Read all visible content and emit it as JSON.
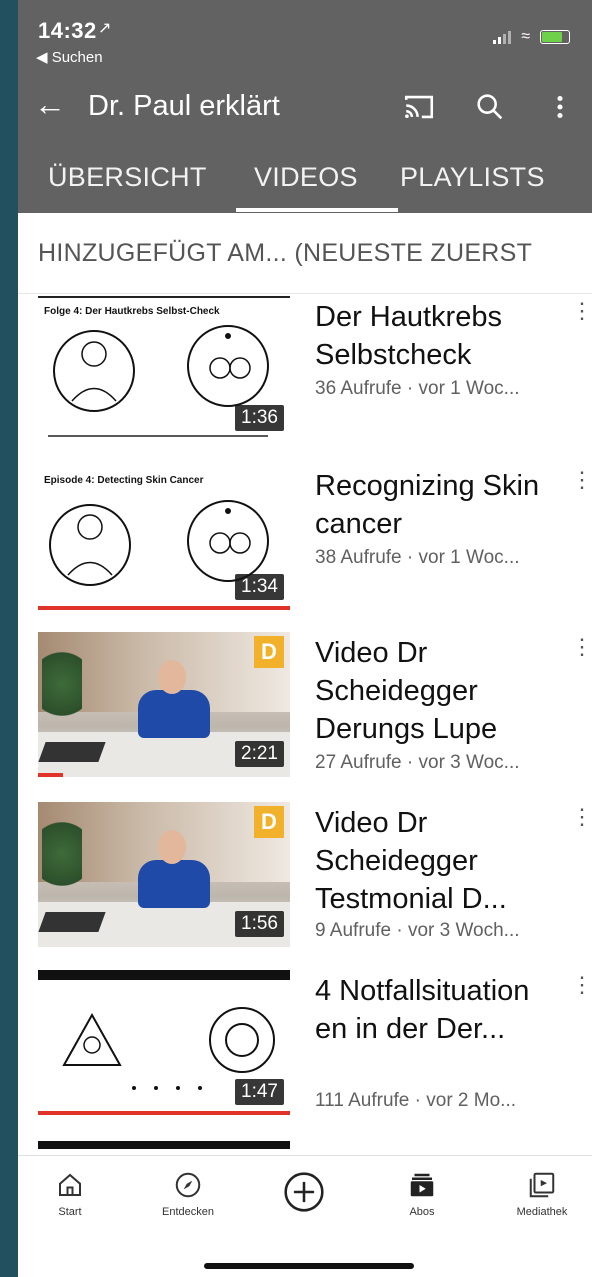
{
  "status_bar": {
    "time": "14:32",
    "location_arrow": "↗",
    "back_label": "◀ Suchen",
    "battery_color": "#6fd04a"
  },
  "header": {
    "title": "Dr. Paul erklärt",
    "background": "#626262",
    "icons": [
      "back-arrow-icon",
      "cast-icon",
      "search-icon",
      "more-vertical-icon"
    ]
  },
  "tabs": [
    {
      "label": "ÜBERSICHT",
      "selected": false
    },
    {
      "label": "VIDEOS",
      "selected": true
    },
    {
      "label": "PLAYLISTS",
      "selected": false
    }
  ],
  "sort": {
    "label": "HINZUGEFÜGT AM... (NEUESTE ZUERST"
  },
  "videos": [
    {
      "title": "Der Hautkrebs Selbstcheck",
      "meta": "36 Aufrufe · vor 1 Woc...",
      "duration": "1:36",
      "thumb_caption": "Folge 4: Der Hautkrebs Selbst-Check",
      "watched_fraction": 0.0
    },
    {
      "title": "Recognizing Skin cancer",
      "meta": "38 Aufrufe · vor 1 Woc...",
      "duration": "1:34",
      "thumb_caption": "Episode 4: Detecting Skin Cancer",
      "watched_fraction": 1.0
    },
    {
      "title": "Video Dr Scheidegger Derungs Lupe",
      "meta": "27 Aufrufe · vor 3 Woc...",
      "duration": "2:21",
      "badge": "D",
      "watched_fraction": 0.1
    },
    {
      "title": "Video Dr Scheidegger Testmonial  D...",
      "meta": "9 Aufrufe · vor 3 Woch...",
      "duration": "1:56",
      "badge": "D",
      "watched_fraction": 0.0
    },
    {
      "title": "4 Notfallsituation en in der Der...",
      "meta": "111 Aufrufe · vor 2 Mo...",
      "duration": "1:47",
      "watched_fraction": 1.0
    }
  ],
  "bottom_nav": [
    {
      "label": "Start",
      "icon": "home-icon"
    },
    {
      "label": "Entdecken",
      "icon": "compass-icon"
    },
    {
      "label": "",
      "icon": "create-plus-icon"
    },
    {
      "label": "Abos",
      "icon": "subscriptions-icon"
    },
    {
      "label": "Mediathek",
      "icon": "library-icon"
    }
  ],
  "colors": {
    "progress_red": "#e0342a",
    "duration_bg": "#141414",
    "badge_orange": "#f2b12b",
    "left_strip": "#22505e"
  }
}
